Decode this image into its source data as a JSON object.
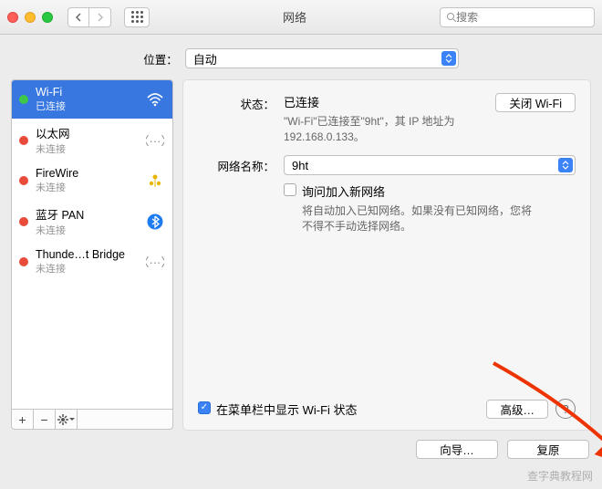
{
  "window": {
    "title": "网络",
    "search_placeholder": "搜索"
  },
  "location": {
    "label": "位置：",
    "value": "自动"
  },
  "sidebar": {
    "items": [
      {
        "name": "Wi-Fi",
        "status": "已连接",
        "dot": "green",
        "icon": "wifi",
        "selected": true
      },
      {
        "name": "以太网",
        "status": "未连接",
        "dot": "red",
        "icon": "ethernet",
        "selected": false
      },
      {
        "name": "FireWire",
        "status": "未连接",
        "dot": "red",
        "icon": "firewire",
        "selected": false
      },
      {
        "name": "蓝牙 PAN",
        "status": "未连接",
        "dot": "red",
        "icon": "bluetooth",
        "selected": false
      },
      {
        "name": "Thunde…t Bridge",
        "status": "未连接",
        "dot": "red",
        "icon": "thunderbolt",
        "selected": false
      }
    ],
    "controls": {
      "add": "+",
      "remove": "−",
      "gear": ""
    }
  },
  "detail": {
    "status_label": "状态：",
    "status_value": "已连接",
    "toggle_button": "关闭 Wi-Fi",
    "status_desc": "\"Wi-Fi\"已连接至\"9ht\"，其 IP 地址为 192.168.0.133。",
    "network_label": "网络名称：",
    "network_value": "9ht",
    "ask_join_label": "询问加入新网络",
    "ask_join_checked": false,
    "ask_join_desc": "将自动加入已知网络。如果没有已知网络，您将不得不手动选择网络。",
    "menubar_label": "在菜单栏中显示 Wi-Fi 状态",
    "menubar_checked": true,
    "advanced_button": "高级…",
    "help": "?"
  },
  "footer": {
    "assist": "向导…",
    "restore": "复原"
  },
  "watermark": "查字典教程网"
}
